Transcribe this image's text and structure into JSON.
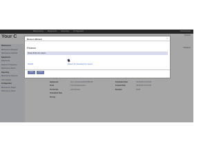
{
  "topbar": {
    "menu": [
      "Maintenance",
      "Equipments",
      "Reporting",
      "Configuration"
    ],
    "user": "Administrator"
  },
  "logo_text": "Your C",
  "sidebar": {
    "items": [
      {
        "label": "Maintenance",
        "section": true
      },
      {
        "label": "Maintenance Requests",
        "section": false
      },
      {
        "label": "Maintenance Calendar",
        "section": false
      },
      {
        "label": "Equipments",
        "section": true
      },
      {
        "label": "Equipments",
        "section": false
      },
      {
        "label": "Equipment Categories",
        "section": false
      },
      {
        "label": "Maintenance Teams",
        "section": false
      },
      {
        "label": "Reporting",
        "section": true
      },
      {
        "label": "Maintenance Requests",
        "section": false
      },
      {
        "label": "Cost Analysis",
        "section": false
      },
      {
        "label": "Configuration",
        "section": true
      },
      {
        "label": "Maintenance Stages",
        "section": false
      },
      {
        "label": "Maintenance Teams",
        "section": false
      }
    ]
  },
  "background_right": {
    "line1": "Discard",
    "line2": "Repaired"
  },
  "form": {
    "rows": [
      {
        "label": "Category",
        "value": "Computers",
        "label2": "Requested By",
        "value2": "Administrator"
      },
      {
        "label": "Equipment",
        "value": "Acer Laptop/LP/203/19281928",
        "label2": "Scheduled Date",
        "value2": "03/19/2016 00:00:00"
      },
      {
        "label": "Team",
        "value": "Internal Maintenance",
        "label2": "Created Date",
        "value2": "03/19/2016 00:00:00"
      },
      {
        "label": "Technician",
        "value": "Administrator",
        "label2": "Duration",
        "value2": "00:00"
      },
      {
        "label": "Scheduled Date",
        "value": "",
        "label2": "",
        "value2": ""
      },
      {
        "label": "Priority",
        "value": "",
        "label2": "",
        "value2": ""
      }
    ]
  },
  "modal": {
    "title": "Reason Wizard",
    "close": "×",
    "reason_label": "Reason",
    "reason_value": "Please fill the the reason",
    "discard_link": "Discard",
    "tooltip": "Reason for cancelling the request",
    "done_button": "Done",
    "cancel_button": "Cancel"
  }
}
